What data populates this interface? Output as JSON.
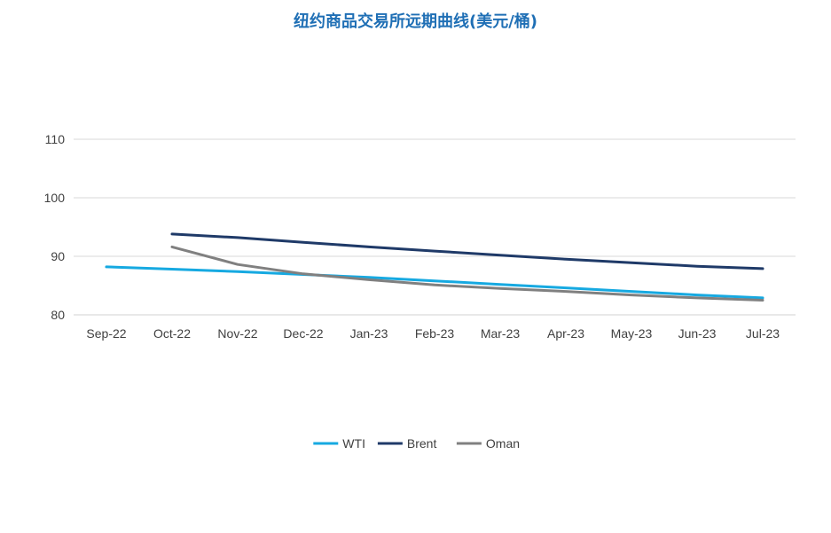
{
  "chart_data": {
    "type": "line",
    "title": "纽约商品交易所远期曲线(美元/桶)",
    "xlabel": "",
    "ylabel": "",
    "categories": [
      "Sep-22",
      "Oct-22",
      "Nov-22",
      "Dec-22",
      "Jan-23",
      "Feb-23",
      "Mar-23",
      "Apr-23",
      "May-23",
      "Jun-23",
      "Jul-23"
    ],
    "yticks": [
      80,
      90,
      100,
      110
    ],
    "ylim": [
      80,
      110
    ],
    "grid": true,
    "legend_position": "bottom",
    "series": [
      {
        "name": "WTI",
        "color": "#16a9e1",
        "values": [
          88.2,
          87.8,
          87.4,
          86.9,
          86.4,
          85.8,
          85.2,
          84.6,
          84.0,
          83.4,
          82.9
        ]
      },
      {
        "name": "Brent",
        "color": "#1f3a68",
        "values": [
          null,
          93.8,
          93.2,
          92.4,
          91.6,
          90.9,
          90.2,
          89.5,
          88.9,
          88.3,
          87.9
        ]
      },
      {
        "name": "Oman",
        "color": "#808080",
        "values": [
          null,
          91.6,
          88.6,
          87.0,
          86.0,
          85.1,
          84.5,
          84.0,
          83.4,
          82.9,
          82.5
        ]
      }
    ]
  }
}
